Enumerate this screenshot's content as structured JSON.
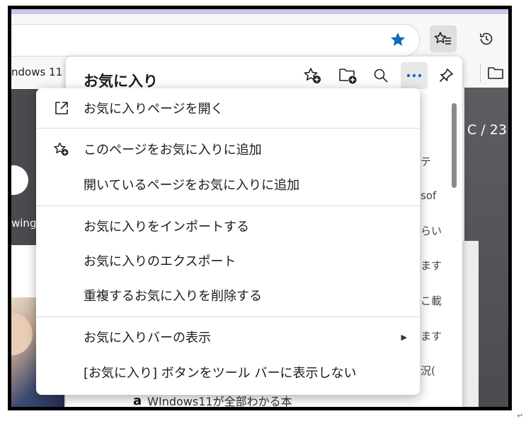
{
  "bookmarks_bar": {
    "partial_text": "ndows 11"
  },
  "page_peek": {
    "right_text": "C / 23",
    "left_text": "wing"
  },
  "favorites": {
    "title": "お気に入り",
    "toolbar_icons": [
      "add-favorite-icon",
      "add-folder-icon",
      "search-icon",
      "more-icon",
      "pin-icon"
    ],
    "peek_texts": [
      "テ",
      "sof",
      "らい",
      "ます",
      "こ載",
      "ます",
      "況("
    ],
    "bottom_item": "WIndows11が全部わかる本"
  },
  "menu": {
    "items": [
      {
        "label": "お気に入りページを開く",
        "icon": "open-external-icon"
      },
      {
        "label": "このページをお気に入りに追加",
        "icon": "add-favorite-icon"
      },
      {
        "label": "開いているページをお気に入りに追加",
        "icon": ""
      },
      {
        "label": "お気に入りをインポートする",
        "icon": ""
      },
      {
        "label": "お気に入りのエクスポート",
        "icon": ""
      },
      {
        "label": "重複するお気に入りを削除する",
        "icon": ""
      },
      {
        "label": "お気に入りバーの表示",
        "icon": "",
        "submenu_arrow": "▶"
      },
      {
        "label": "[お気に入り] ボタンをツール バーに表示しない",
        "icon": ""
      }
    ]
  },
  "colors": {
    "accent": "#0f6cbd",
    "more_dots": "#0f6cbd"
  },
  "corner_glyph": "↵"
}
